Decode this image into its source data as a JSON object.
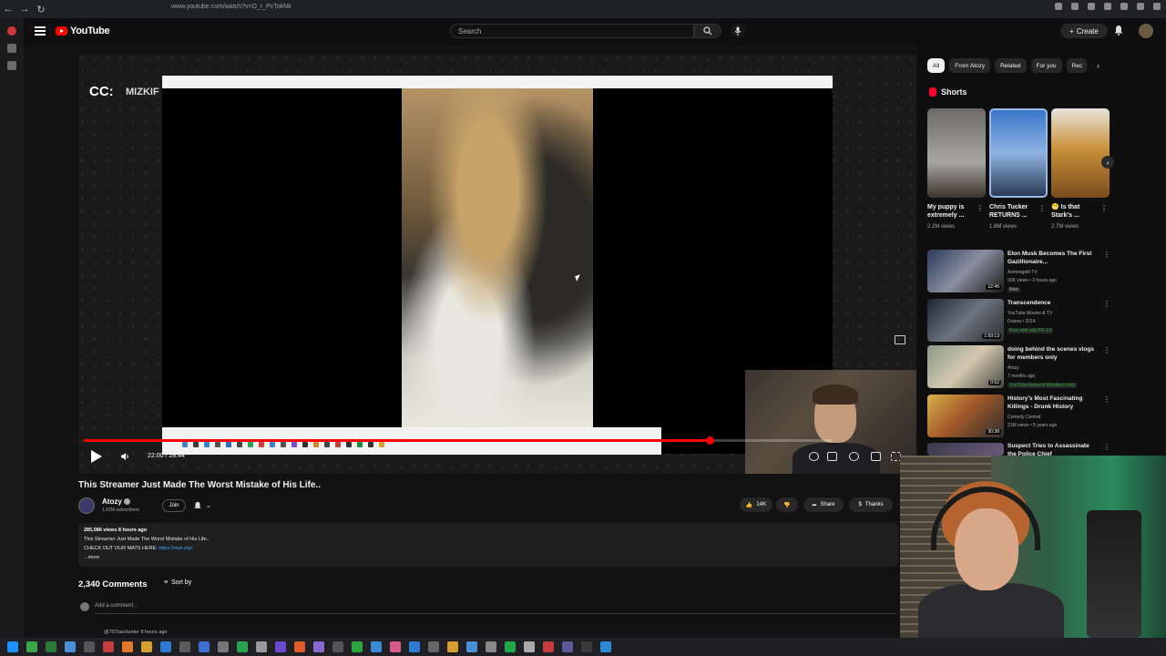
{
  "browser": {
    "url": "www.youtube.com/watch?v=O_r_PvTokNk"
  },
  "masthead": {
    "logo_text": "YouTube",
    "search_placeholder": "Search",
    "create_label": "Create"
  },
  "player": {
    "cc_label": "CC:",
    "cc_name": "MIZKIF",
    "current_time": "22:00",
    "duration": "28:44",
    "time_readout": "22:00 / 28:44",
    "progress": 0.8357
  },
  "video": {
    "title": "This Streamer Just Made The Worst Mistake of His Life..",
    "channel_name": "Atozy",
    "subscribers": "1.91M subscribers",
    "join_label": "Join",
    "like_count": "14K",
    "share_label": "Share",
    "thanks_label": "Thanks",
    "description": {
      "views_line": "285,086 views  8 hours ago",
      "line1": "This Streamer Just Made The Worst Mistake of His Life..",
      "line2_prefix": "CHECK OUT OUR MATS HERE: ",
      "line2_link": "https://mat.city/",
      "more": "...more"
    }
  },
  "comments": {
    "count_label": "2,340 Comments",
    "sort_label": "Sort by",
    "add_placeholder": "Add a comment...",
    "next_author": "@707zachunter  8 hours ago"
  },
  "sidebar": {
    "chips": [
      "All",
      "From Atozy",
      "Related",
      "For you",
      "Rec"
    ],
    "shorts_header": "Shorts",
    "shorts": [
      {
        "title": "My puppy is extremely ...",
        "views": "2.2M views"
      },
      {
        "title": "Chris Tucker RETURNS ...",
        "views": "1.6M views"
      },
      {
        "title": "😬 Is that Stark's ...",
        "views": "2.7M views"
      }
    ],
    "related": [
      {
        "title": "Elon Musk Becomes The First Gazillionaire...",
        "channel": "Asmongold TV",
        "meta": "92K views • 2 hours ago",
        "badge": "New",
        "duration": "12:46"
      },
      {
        "title": "Transcendence",
        "channel": "YouTube Movies & TV",
        "meta": "Drama • 2014",
        "badge": "Free with ads  PG-13",
        "duration": "1:59:13"
      },
      {
        "title": "doing behind the scenes vlogs for members only",
        "channel": "Atozy",
        "meta": "7 months ago",
        "badge": "YouTube featured  Members only",
        "duration": "0:52"
      },
      {
        "title": "History's Most Fascinating Killings - Drunk History",
        "channel": "Comedy Central",
        "meta": "21M views • 5 years ago",
        "badge": "",
        "duration": "30:38"
      },
      {
        "title": "Suspect Tries to Assassinate the Police Chief",
        "channel": "",
        "meta": "",
        "badge": "",
        "duration": ""
      }
    ]
  },
  "colors": {
    "accent": "#ff0000",
    "background": "#0f0f0f",
    "link": "#3ea6ff"
  }
}
